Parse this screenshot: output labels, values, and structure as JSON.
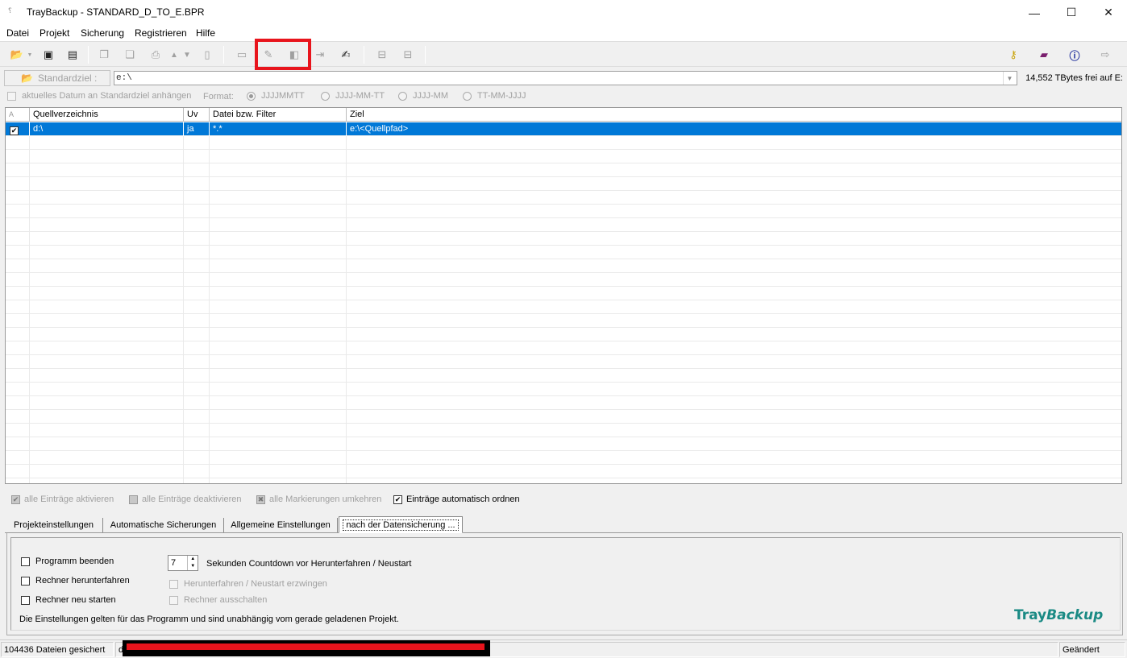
{
  "window": {
    "title": "TrayBackup  -  STANDARD_D_TO_E.BPR",
    "app_icon": "tray-icon",
    "minimize": "—",
    "maximize": "☐",
    "close": "✕"
  },
  "menu": [
    "Datei",
    "Projekt",
    "Sicherung",
    "Registrieren",
    "Hilfe"
  ],
  "toolbar": {
    "left_icons": [
      "open-folder-icon",
      "dropdown-arrow-icon",
      "save-icon",
      "save-as-icon",
      "copy-icon",
      "paste-icon",
      "print-icon",
      "move-up-icon",
      "move-down-icon",
      "new-document-icon",
      "list-icon",
      "edit-entry-icon",
      "delete-entry-icon",
      "indent-icon",
      "notepad-edit-icon",
      "network-drive-icon",
      "network-drive-2-icon"
    ],
    "right_icons": [
      "key-icon",
      "book-icon",
      "info-icon",
      "exit-icon"
    ]
  },
  "standard_target": {
    "button_label": "Standardziel :",
    "value": "e:\\",
    "free_space": "14,552 TBytes frei auf E:"
  },
  "date_options": {
    "append_label": "aktuelles Datum an Standardziel anhängen",
    "format_label": "Format:",
    "formats": [
      "JJJJMMTT",
      "JJJJ-MM-TT",
      "JJJJ-MM",
      "TT-MM-JJJJ"
    ],
    "selected_format": "JJJJMMTT"
  },
  "table": {
    "sort_indicator": "A",
    "columns": [
      "Quellverzeichnis",
      "Uv",
      "Datei  bzw. Filter",
      "Ziel"
    ],
    "rows": [
      {
        "checked": true,
        "source": "d:\\",
        "subdirs": "ja",
        "filter": "*.*",
        "target": "e:\\<Quellpfad>"
      }
    ]
  },
  "list_actions": {
    "activate_all": "alle Einträge aktivieren",
    "deactivate_all": "alle Einträge deaktivieren",
    "invert_marks": "alle Markierungen umkehren",
    "auto_sort": "Einträge automatisch ordnen"
  },
  "tabs": [
    "Projekteinstellungen",
    "Automatische Sicherungen",
    "Allgemeine Einstellungen",
    "nach der Datensicherung ..."
  ],
  "active_tab": "nach der Datensicherung ...",
  "after_backup": {
    "quit_program": "Programm beenden",
    "shutdown": "Rechner herunterfahren",
    "restart": "Rechner neu starten",
    "countdown_value": "7",
    "countdown_label": "Sekunden Countdown vor Herunterfahren / Neustart",
    "force_label": "Herunterfahren / Neustart erzwingen",
    "poweroff_label": "Rechner ausschalten",
    "note": "Die Einstellungen gelten für das Programm und sind unabhängig vom gerade geladenen Projekt."
  },
  "brand": {
    "part1": "Tray",
    "part2": "Backup"
  },
  "status": {
    "files_saved": "104436 Dateien gesichert",
    "path_prefix": "d",
    "state": "Geändert"
  }
}
